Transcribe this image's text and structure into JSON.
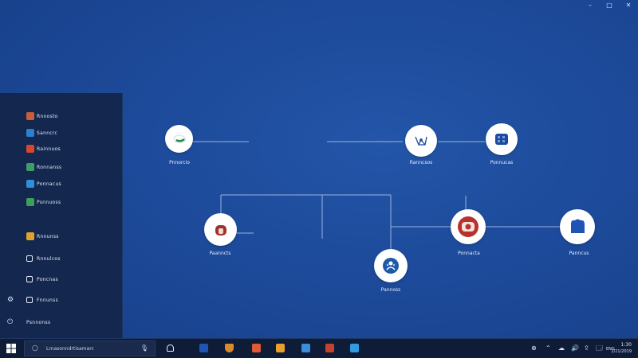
{
  "window_controls": {
    "minimize": "–",
    "maximize": "□",
    "close": "✕"
  },
  "start_menu": {
    "items": [
      {
        "label": "Rnnosto",
        "icon": "app-icon",
        "color": "#c95e3a"
      },
      {
        "label": "Sanncrc",
        "icon": "app-icon",
        "color": "#2e7fd0"
      },
      {
        "label": "Rainnuos",
        "icon": "app-icon",
        "color": "#d9462f"
      },
      {
        "label": "Ronnanss",
        "icon": "app-icon",
        "color": "#3c9f6a"
      },
      {
        "label": "Ponnacus",
        "icon": "app-icon",
        "color": "#2f8fdb"
      },
      {
        "label": "Psnnuoss",
        "icon": "app-icon",
        "color": "#3aa05a"
      },
      {
        "label": "Rnnunss",
        "icon": "app-icon",
        "color": "#e0a12e"
      },
      {
        "label": "Rnnulcos",
        "icon": "app-icon",
        "color": "#e8eef8"
      },
      {
        "label": "Poncnas",
        "icon": "app-icon",
        "color": "#e8eef8"
      },
      {
        "label": "Fnnunss",
        "icon": "app-icon",
        "color": "#e8eef8"
      }
    ],
    "power_glyph": "⏻",
    "power_label": "Psnnonss",
    "settings_glyph": "⚙"
  },
  "diagram": {
    "nodes": [
      {
        "id": "n1",
        "label": "Pnnorcio",
        "icon": "chat-icon",
        "accent": "#1f8a4c"
      },
      {
        "id": "n2",
        "label": "Ranncsos",
        "icon": "network-icon",
        "accent": "#1d4a9a"
      },
      {
        "id": "n3",
        "label": "Ponnucas",
        "icon": "grid-icon",
        "accent": "#1d4a9a"
      },
      {
        "id": "n4",
        "label": "Paanncts",
        "icon": "bag-icon",
        "accent": "#a0332c"
      },
      {
        "id": "n5",
        "label": "Pannoss",
        "icon": "people-icon",
        "accent": "#1e5aa8"
      },
      {
        "id": "n6",
        "label": "Ponnacta",
        "icon": "photo-icon",
        "accent": "#b8322d"
      },
      {
        "id": "n7",
        "label": "Panncus",
        "icon": "cloud-icon",
        "accent": "#1e55b5"
      }
    ]
  },
  "taskbar": {
    "search_placeholder": "Lrnasonndrtisamarc",
    "search_glyph": "○",
    "mic_glyph": "🎙",
    "apps": [
      {
        "name": "headset-icon",
        "color": "#e8eef8"
      },
      {
        "name": "file-icon",
        "color": "#1f55b5"
      },
      {
        "name": "shield-icon",
        "color": "#d98a2b"
      },
      {
        "name": "photo-icon",
        "color": "#e05a37"
      },
      {
        "name": "folder-icon",
        "color": "#e8a12e"
      },
      {
        "name": "chart-icon",
        "color": "#3a8fd8"
      },
      {
        "name": "media-icon",
        "color": "#c2432e"
      },
      {
        "name": "edge-icon",
        "color": "#2f9be0"
      }
    ],
    "tray": {
      "items": [
        "⊕",
        "⌃",
        "☁",
        "🔊",
        "⇪",
        "🗔"
      ],
      "lang": "ENG",
      "time": "1:30",
      "date": "2/21/2019"
    }
  }
}
